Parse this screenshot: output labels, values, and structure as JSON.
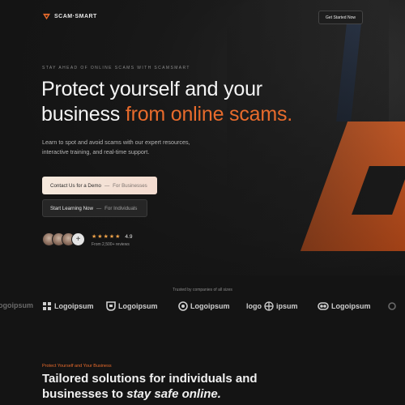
{
  "brand": {
    "name": "SCAM·SMART",
    "accent_color": "#e86b2c"
  },
  "nav": {
    "cta_label": "Get Started Now"
  },
  "hero": {
    "eyebrow": "STAY AHEAD OF ONLINE SCAMS WITH SCAMSMART",
    "headline_main": "Protect yourself and your business",
    "headline_accent": "from online scams.",
    "subtext": "Learn to spot and avoid scams with our expert resources, interactive training, and real-time support.",
    "primary_button": {
      "label": "Contact Us for a Demo",
      "sub": "For Businesses"
    },
    "secondary_button": {
      "label": "Start Learning Now",
      "sub": "For Individuals"
    },
    "rating": {
      "stars": 5,
      "value": "4.9",
      "reviews": "From 2,500+ reviews"
    }
  },
  "trusted": {
    "label": "Trusted by companies of all sizes",
    "logos": [
      "ogoipsum",
      "Logoipsum",
      "Logoipsum",
      "Logoipsum",
      "logo",
      "ipsum",
      "Logoipsum"
    ]
  },
  "solutions": {
    "eyebrow": "Protect Yourself and Your Business",
    "title_main": "Tailored solutions for individuals and businesses to",
    "title_italic": "stay safe online."
  }
}
